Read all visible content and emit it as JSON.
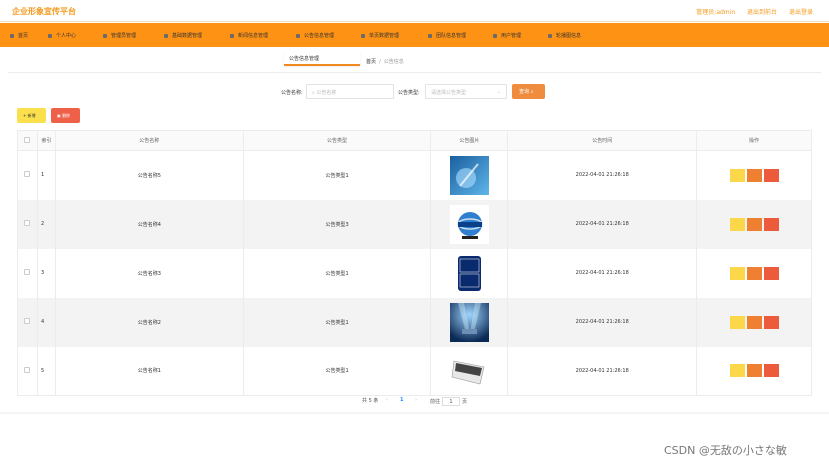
{
  "app": {
    "title": "企业形象宣传平台"
  },
  "top_links": [
    "管理员:admin",
    "退出到前台",
    "退出登录"
  ],
  "nav": [
    "首页",
    "个人中心",
    "管理员管理",
    "基础数据管理",
    "新闻信息管理",
    "公告信息管理",
    "单页数据管理",
    "团队信息管理",
    "用户管理",
    "轮播图信息"
  ],
  "tab": {
    "label": "公告信息管理"
  },
  "breadcrumb": {
    "home": "首页",
    "separator": "/",
    "current": "公告信息"
  },
  "search": {
    "name_label": "公告名称:",
    "name_placeholder": "公告名称",
    "type_label": "公告类型:",
    "type_placeholder": "请选择公告类型",
    "button": "查询"
  },
  "actions": {
    "add": "+ 新增",
    "delete": "删除"
  },
  "table": {
    "headers": [
      "",
      "索引",
      "公告名称",
      "公告类型",
      "公告图片",
      "公告时间",
      "操作"
    ],
    "rows": [
      {
        "index": "1",
        "name": "公告名称5",
        "type": "公告类型1",
        "image": "blue-abstract",
        "time": "2022-04-01 21:26:18"
      },
      {
        "index": "2",
        "name": "公告名称4",
        "type": "公告类型3",
        "image": "globe-news",
        "time": "2022-04-01 21:26:18"
      },
      {
        "index": "3",
        "name": "公告名称3",
        "type": "公告类型1",
        "image": "cctv-news-logo",
        "time": "2022-04-01 21:26:18"
      },
      {
        "index": "4",
        "name": "公告名称2",
        "type": "公告类型1",
        "image": "stage-lights",
        "time": "2022-04-01 21:26:18"
      },
      {
        "index": "5",
        "name": "公告名称1",
        "type": "公告类型1",
        "image": "news-newspaper",
        "time": "2022-04-01 21:26:18"
      }
    ]
  },
  "pagination": {
    "total": "共 5 条",
    "prev": "‹",
    "current": "1",
    "next": "›",
    "goto": "前往",
    "page_value": "1",
    "page_unit": "页"
  },
  "watermark": "CSDN @无敌の小さな敏",
  "colors": {
    "brand": "#f39a1d",
    "nav": "#fe9214",
    "search": "#ef8c3d",
    "add": "#f9e04c",
    "delete": "#ee6048"
  }
}
